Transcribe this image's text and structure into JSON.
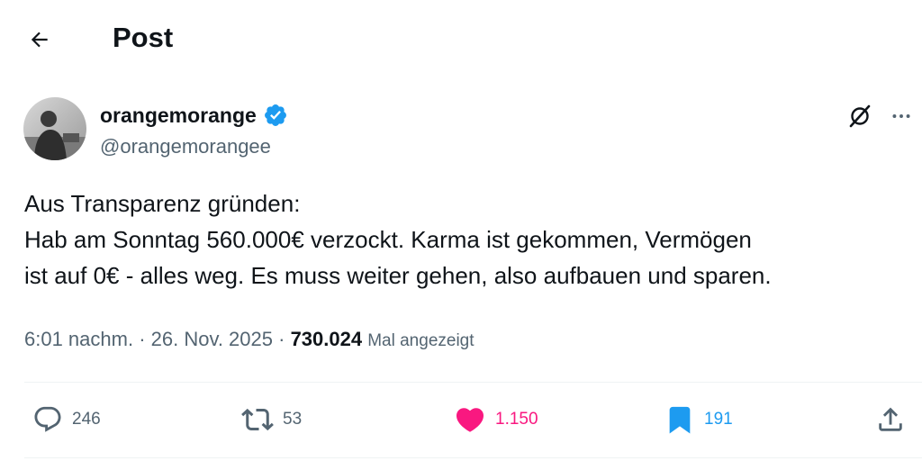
{
  "header": {
    "title": "Post",
    "back_icon": "arrow-left-icon"
  },
  "author": {
    "name": "orangemorange",
    "handle": "@orangemorangee",
    "verified": true,
    "verified_color": "#1d9bf0"
  },
  "tweet": {
    "lines": [
      "Aus Transparenz gründen:",
      "Hab am Sonntag 560.000€ verzockt. Karma ist gekommen, Vermögen",
      "ist auf 0€ - alles weg. Es muss weiter gehen, also aufbauen und sparen."
    ]
  },
  "meta": {
    "time": "6:01 nachm.",
    "separator": " · ",
    "date": "26. Nov. 2025",
    "views_count": "730.024",
    "views_label": "Mal angezeigt"
  },
  "actions": {
    "reply": {
      "count": "246",
      "icon": "reply-icon"
    },
    "repost": {
      "count": "53",
      "icon": "repost-icon"
    },
    "like": {
      "count": "1.150",
      "icon": "heart-icon",
      "color": "#f91880",
      "active": true
    },
    "bookmark": {
      "count": "191",
      "icon": "bookmark-icon",
      "color": "#1d9bf0",
      "active": true
    },
    "share": {
      "icon": "share-icon"
    }
  },
  "colors": {
    "text_primary": "#0f1419",
    "text_secondary": "#536471",
    "divider": "#eff3f4"
  }
}
